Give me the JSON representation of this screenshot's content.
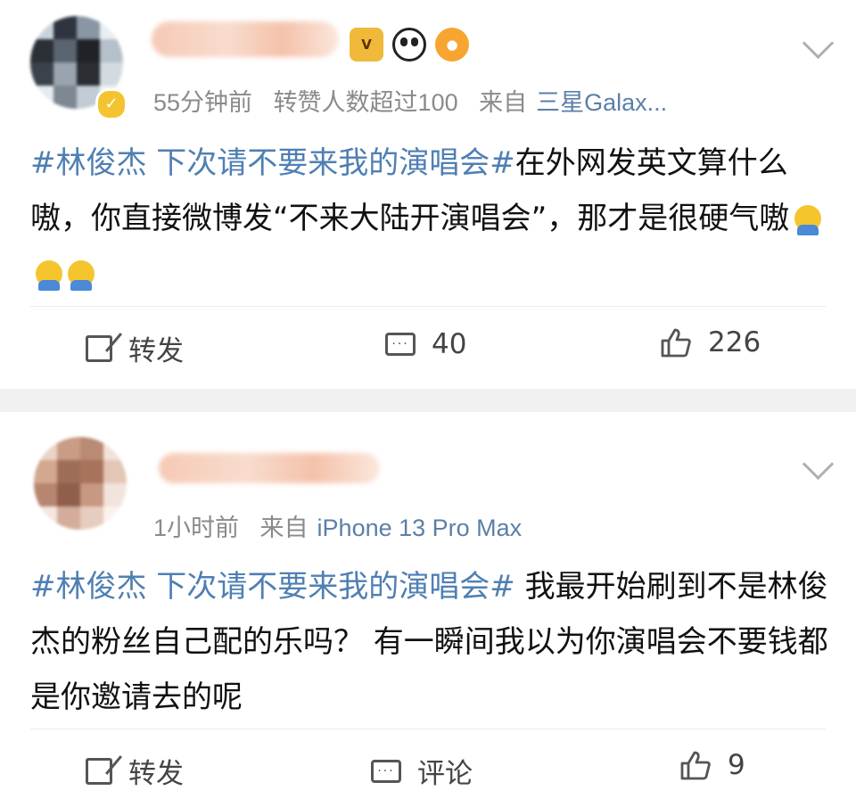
{
  "colors": {
    "topic": "#4f7fb3",
    "meta": "#8a8a8a",
    "source": "#5b7fa8"
  },
  "posts": [
    {
      "time": "55分钟前",
      "extra": "转赞人数超过100",
      "source_prefix": "来自",
      "source": "三星Galax...",
      "topic": "#林俊杰 下次请不要来我的演唱会#",
      "body": "在外网发英文算什么嗷，你直接微博发“不来大陆开演唱会”，那才是很硬气嗷",
      "emoji": [
        "shrug-emoji",
        "shrug-emoji",
        "shrug-emoji"
      ],
      "actions": {
        "repost": "转发",
        "comment": "40",
        "like": "226"
      }
    },
    {
      "time": "1小时前",
      "source_prefix": "来自",
      "source": "iPhone 13 Pro Max",
      "topic": "#林俊杰 下次请不要来我的演唱会#",
      "body": " 我最开始刷到不是林俊杰的粉丝自己配的乐吗？ 有一瞬间我以为你演唱会不要钱都是你邀请去的呢",
      "actions": {
        "repost": "转发",
        "comment": "评论",
        "like": "9"
      }
    }
  ]
}
